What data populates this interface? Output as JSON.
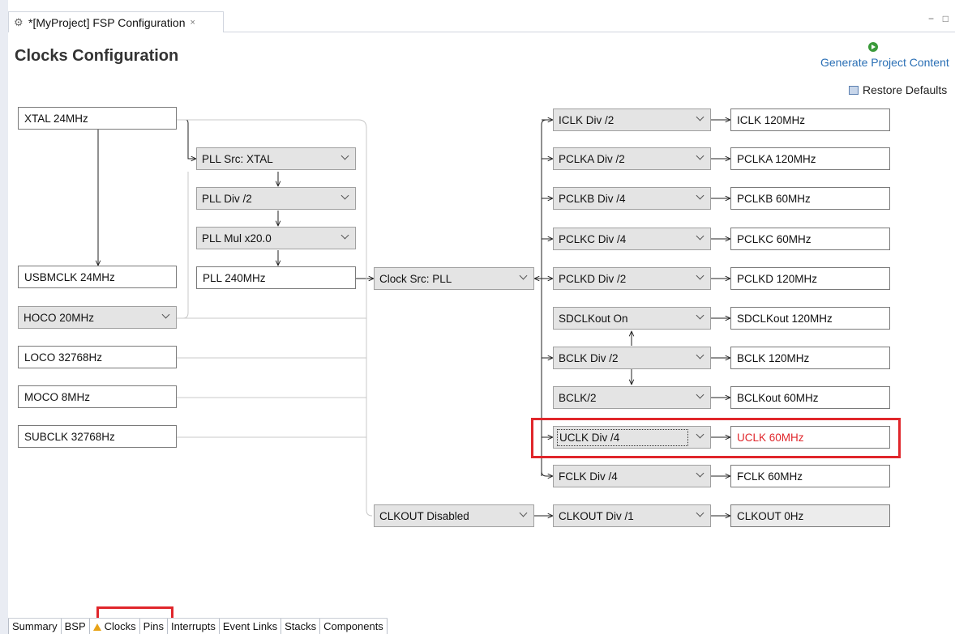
{
  "editor": {
    "tab_title": "*[MyProject] FSP Configuration",
    "tab_close": "×",
    "win_min": "−",
    "win_max": "□"
  },
  "header": {
    "title": "Clocks Configuration",
    "generate_label": "Generate Project Content",
    "restore_label": "Restore Defaults"
  },
  "sources": {
    "xtal": "XTAL 24MHz",
    "usbmclk": "USBMCLK 24MHz",
    "hoco": "HOCO 20MHz",
    "loco": "LOCO 32768Hz",
    "moco": "MOCO 8MHz",
    "subclk": "SUBCLK 32768Hz"
  },
  "pll": {
    "src": "PLL Src: XTAL",
    "div": "PLL Div /2",
    "mul": "PLL Mul x20.0",
    "out": "PLL 240MHz"
  },
  "clock_src": "Clock Src: PLL",
  "clkout_src": "CLKOUT Disabled",
  "dividers": [
    {
      "sel": "ICLK Div /2",
      "out": "ICLK 120MHz"
    },
    {
      "sel": "PCLKA Div /2",
      "out": "PCLKA 120MHz"
    },
    {
      "sel": "PCLKB Div /4",
      "out": "PCLKB 60MHz"
    },
    {
      "sel": "PCLKC Div /4",
      "out": "PCLKC 60MHz"
    },
    {
      "sel": "PCLKD Div /2",
      "out": "PCLKD 120MHz"
    },
    {
      "sel": "SDCLKout On",
      "out": "SDCLKout 120MHz"
    },
    {
      "sel": "BCLK Div /2",
      "out": "BCLK 120MHz"
    },
    {
      "sel": "BCLK/2",
      "out": "BCLKout 60MHz"
    },
    {
      "sel": "UCLK Div /4",
      "out": "UCLK 60MHz"
    },
    {
      "sel": "FCLK Div /4",
      "out": "FCLK 60MHz"
    },
    {
      "sel": "CLKOUT Div /1",
      "out": "CLKOUT 0Hz"
    }
  ],
  "colors": {
    "error_text": "#e0262b",
    "highlight": "#e0262b",
    "link": "#2a6fb5"
  },
  "bottom_tabs": [
    "Summary",
    "BSP",
    "Clocks",
    "Pins",
    "Interrupts",
    "Event Links",
    "Stacks",
    "Components"
  ]
}
